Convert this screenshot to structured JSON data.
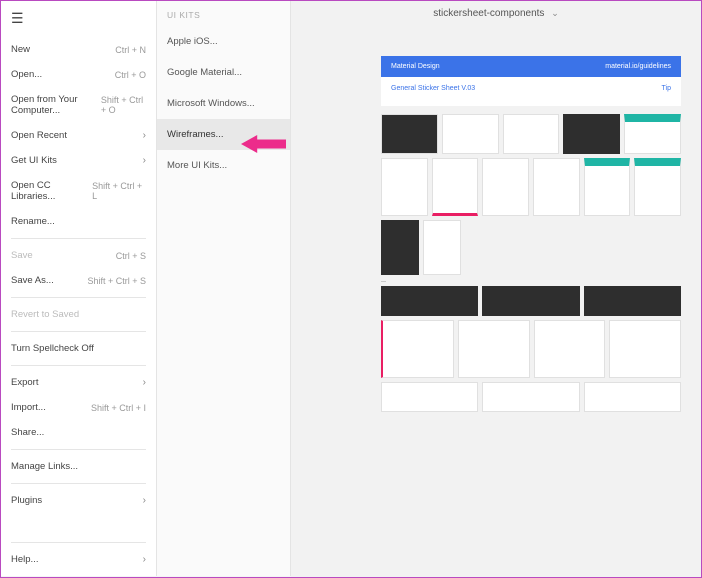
{
  "menu": {
    "items": [
      {
        "label": "New",
        "shortcut": "Ctrl + N",
        "type": "item"
      },
      {
        "label": "Open...",
        "shortcut": "Ctrl + O",
        "type": "item"
      },
      {
        "label": "Open from Your Computer...",
        "shortcut": "Shift + Ctrl + O",
        "type": "item"
      },
      {
        "label": "Open Recent",
        "chevron": true,
        "type": "item"
      },
      {
        "label": "Get UI Kits",
        "chevron": true,
        "type": "item"
      },
      {
        "label": "Open CC Libraries...",
        "shortcut": "Shift + Ctrl + L",
        "type": "item"
      },
      {
        "label": "Rename...",
        "type": "item"
      },
      {
        "type": "divider"
      },
      {
        "label": "Save",
        "shortcut": "Ctrl + S",
        "type": "item",
        "disabled": true
      },
      {
        "label": "Save As...",
        "shortcut": "Shift + Ctrl + S",
        "type": "item"
      },
      {
        "type": "divider"
      },
      {
        "label": "Revert to Saved",
        "type": "item",
        "disabled": true
      },
      {
        "type": "divider"
      },
      {
        "label": "Turn Spellcheck Off",
        "type": "item"
      },
      {
        "type": "divider"
      },
      {
        "label": "Export",
        "chevron": true,
        "type": "item"
      },
      {
        "label": "Import...",
        "shortcut": "Shift + Ctrl + I",
        "type": "item"
      },
      {
        "label": "Share...",
        "type": "item"
      },
      {
        "type": "divider"
      },
      {
        "label": "Manage Links...",
        "type": "item"
      },
      {
        "type": "divider"
      },
      {
        "label": "Plugins",
        "chevron": true,
        "type": "item"
      }
    ],
    "help_label": "Help..."
  },
  "submenu": {
    "title": "UI KITS",
    "items": [
      {
        "label": "Apple iOS..."
      },
      {
        "label": "Google Material..."
      },
      {
        "label": "Microsoft Windows..."
      },
      {
        "label": "Wireframes...",
        "selected": true
      },
      {
        "label": "More UI Kits..."
      }
    ]
  },
  "canvas": {
    "title": "stickersheet-components",
    "blue_left": "Material Design",
    "blue_right": "material.io/guidelines",
    "sheet_title": "General Sticker Sheet V.03",
    "sheet_sub": "",
    "tip_label": "Tip"
  }
}
